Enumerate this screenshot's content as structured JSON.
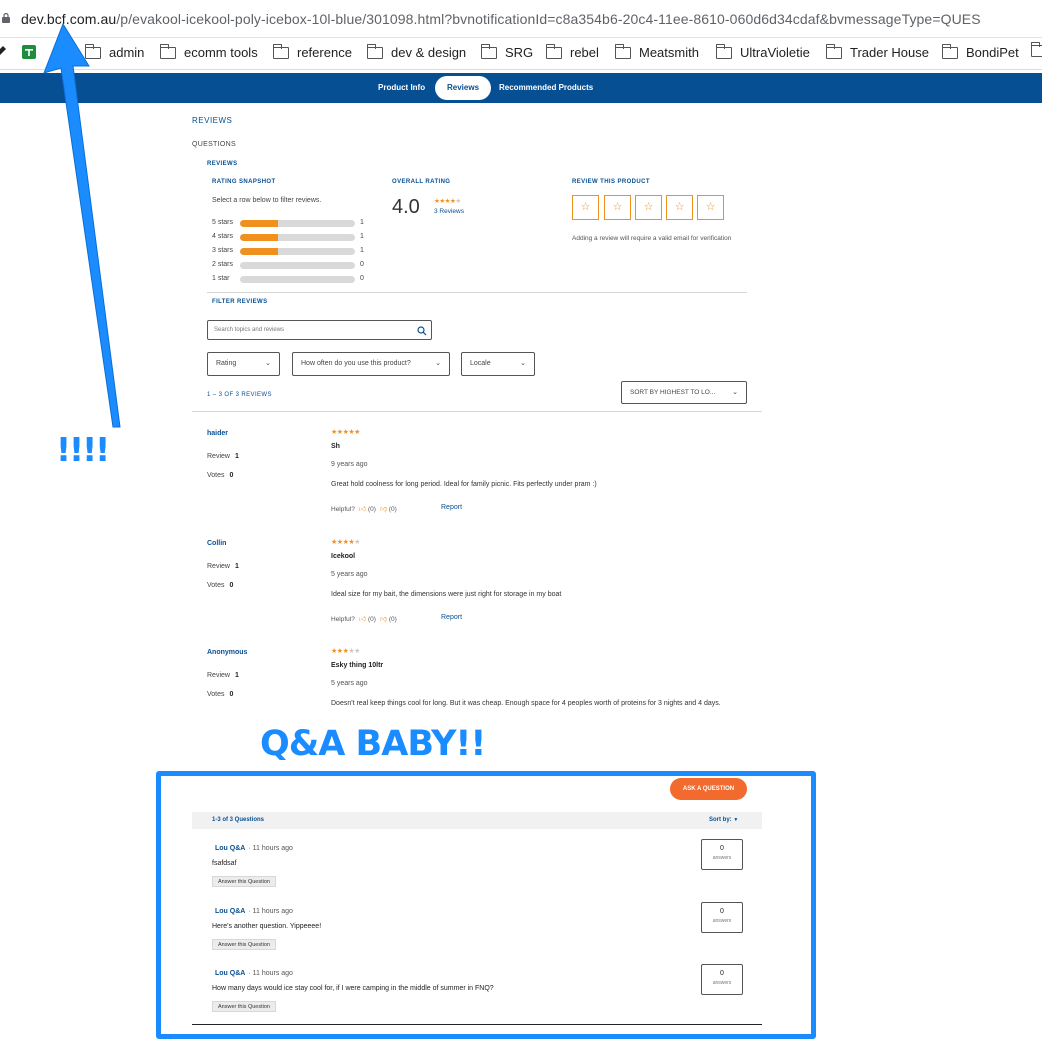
{
  "browser": {
    "url_host": "dev.bcf.com.au",
    "url_path": "/p/evakool-icekool-poly-icebox-10l-blue/301098.html?bvnotificationId=c8a354b6-20c4-11ee-8610-060d6d34cdaf&bvmessageType=QUES",
    "bookmarks": [
      "admin",
      "ecomm tools",
      "reference",
      "dev & design",
      "SRG",
      "rebel",
      "Meatsmith",
      "UltraVioletie",
      "Trader House",
      "BondiPet"
    ]
  },
  "nav": {
    "tabs": [
      "Product Info",
      "Reviews",
      "Recommended Products"
    ],
    "active": "Reviews"
  },
  "page": {
    "reviews_heading": "REVIEWS",
    "questions_link": "QUESTIONS",
    "reviews_subheading": "REVIEWS"
  },
  "snapshot": {
    "title": "RATING SNAPSHOT",
    "hint": "Select a row below to filter reviews.",
    "rows": [
      {
        "label": "5 stars",
        "count": "1",
        "fraction": 0.33
      },
      {
        "label": "4 stars",
        "count": "1",
        "fraction": 0.33
      },
      {
        "label": "3 stars",
        "count": "1",
        "fraction": 0.33
      },
      {
        "label": "2 stars",
        "count": "0",
        "fraction": 0
      },
      {
        "label": "1 star",
        "count": "0",
        "fraction": 0
      }
    ]
  },
  "overall": {
    "title": "OVERALL RATING",
    "value": "4.0",
    "stars_on": 4,
    "reviews_link": "3 Reviews"
  },
  "review_this": {
    "title": "REVIEW THIS PRODUCT",
    "note": "Adding a review will require a valid email for verification"
  },
  "filters": {
    "title": "FILTER REVIEWS",
    "search_placeholder": "Search topics and reviews",
    "rating": "Rating",
    "usage": "How often do you use this product?",
    "locale": "Locale",
    "range": "1 – 3 OF 3 REVIEWS",
    "sort": "SORT BY  HIGHEST TO LO..."
  },
  "reviews": [
    {
      "author": "haider",
      "review_label": "Review",
      "review_count": "1",
      "votes_label": "Votes",
      "votes": "0",
      "stars": 5,
      "title": "Sh",
      "date": "9 years ago",
      "body": "Great hold coolness for long period. Ideal for family picnic. Fits perfectly under pram :)",
      "helpful": "Helpful?",
      "yes": "(0)",
      "no": "(0)",
      "report": "Report"
    },
    {
      "author": "Collin",
      "review_label": "Review",
      "review_count": "1",
      "votes_label": "Votes",
      "votes": "0",
      "stars": 4,
      "title": "Icekool",
      "date": "5 years ago",
      "body": "Ideal size for my bait, the dimensions were just right for storage in my boat",
      "helpful": "Helpful?",
      "yes": "(0)",
      "no": "(0)",
      "report": "Report"
    },
    {
      "author": "Anonymous",
      "review_label": "Review",
      "review_count": "1",
      "votes_label": "Votes",
      "votes": "0",
      "stars": 3,
      "title": "Esky thing 10ltr",
      "date": "5 years ago",
      "body": "Doesn't real keep things cool for long. But it was cheap. Enough space for 4 peoples worth of proteins for 3 nights and 4 days.",
      "helpful": "Helpful?",
      "yes": "(0)",
      "no": "(0)",
      "report": "Report"
    }
  ],
  "annotations": {
    "exclaim": "!!!!",
    "qa_baby": "Q&A BABY!!",
    "color": "#1a8cff"
  },
  "qa": {
    "ask_button": "ASK A QUESTION",
    "range": "1-3 of 3 Questions",
    "sort": "Sort by:",
    "questions": [
      {
        "author": "Lou Q&A",
        "time": "· 11 hours ago",
        "text": "fsafdsaf",
        "answer_btn": "Answer this Question",
        "answers": "0",
        "answers_label": "answers"
      },
      {
        "author": "Lou Q&A",
        "time": "· 11 hours ago",
        "text": "Here's another question. Yippeeee!",
        "answer_btn": "Answer this Question",
        "answers": "0",
        "answers_label": "answers"
      },
      {
        "author": "Lou Q&A",
        "time": "· 11 hours ago",
        "text": "How many days would ice stay cool for, if I were camping in the middle of summer in FNQ?",
        "answer_btn": "Answer this Question",
        "answers": "0",
        "answers_label": "answers"
      }
    ]
  }
}
